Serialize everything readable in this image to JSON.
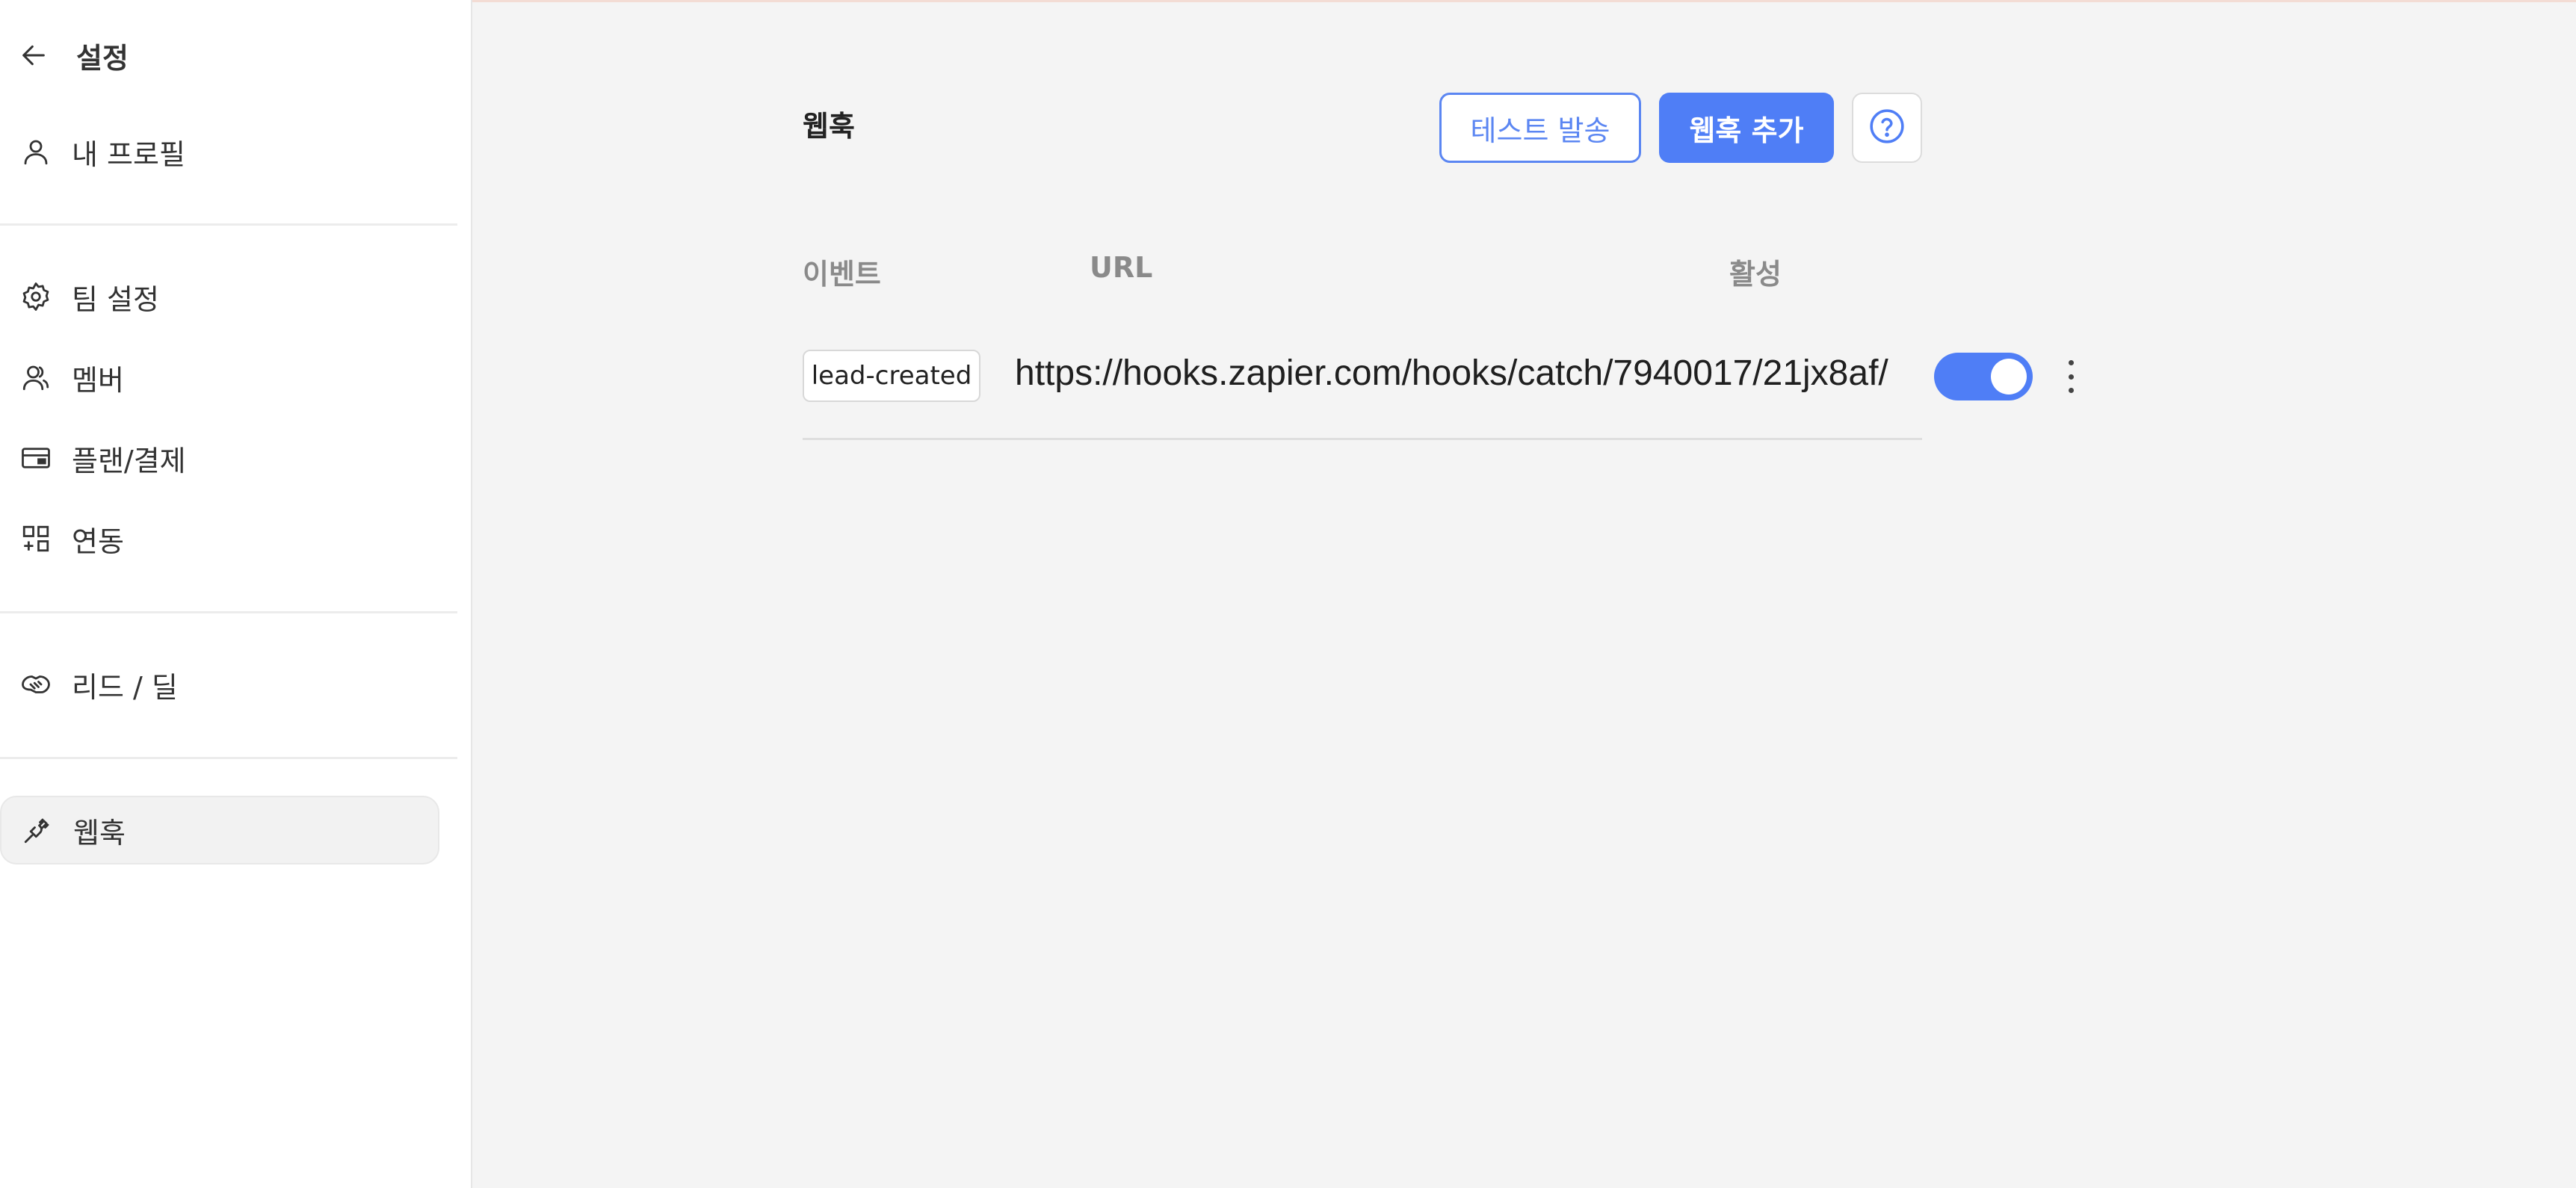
{
  "sidebar": {
    "back_title": "설정",
    "profile": "내 프로필",
    "team_settings": "팀 설정",
    "members": "멤버",
    "plan_billing": "플랜/결제",
    "integrations": "연동",
    "leads_deals": "리드 / 딜",
    "webhooks": "웹훅"
  },
  "main": {
    "title": "웹훅",
    "test_send_label": "테스트 발송",
    "add_webhook_label": "웹훅 추가",
    "columns": {
      "event": "이벤트",
      "url": "URL",
      "active": "활성"
    },
    "rows": [
      {
        "event": "lead-created",
        "url": "https://hooks.zapier.com/hooks/catch/7940017/21jx8af/",
        "active": true
      }
    ]
  },
  "colors": {
    "accent": "#4f7ef6",
    "outline_accent": "#5b86f2"
  }
}
